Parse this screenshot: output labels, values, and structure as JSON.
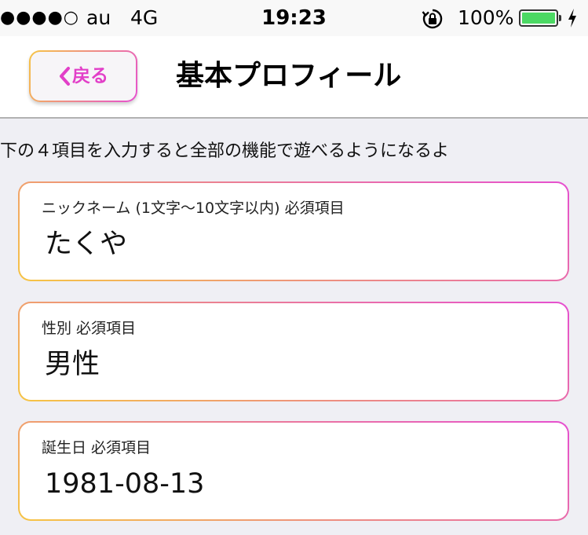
{
  "status_bar": {
    "signal": "●●●●○",
    "carrier": "au",
    "network": "4G",
    "time": "19:23",
    "battery_percent": "100%",
    "battery_level": 1.0,
    "battery_color": "#4cd964",
    "lock_icon": "rotation-lock-icon",
    "charging_icon": "charging-bolt-icon"
  },
  "nav": {
    "back_label": "戻る",
    "back_icon": "chevron-left-icon",
    "title": "基本プロフィール",
    "accent_color": "#e23fc8"
  },
  "instructions": "下の４項目を入力すると全部の機能で遊べるようになるよ",
  "fields": [
    {
      "label": "ニックネーム (1文字〜10文字以内) 必須項目",
      "value": "たくや"
    },
    {
      "label": "性別 必須項目",
      "value": "男性"
    },
    {
      "label": "誕生日 必須項目",
      "value": "1981-08-13"
    }
  ],
  "colors": {
    "gradient_start": "#f6c544",
    "gradient_end": "#e64fd0",
    "background": "#efeff4"
  }
}
